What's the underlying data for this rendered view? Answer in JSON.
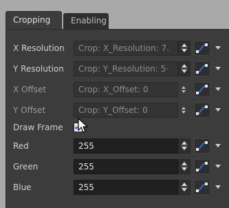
{
  "tabs": [
    {
      "label": "Cropping",
      "active": true
    },
    {
      "label": "Enabling",
      "active": false
    }
  ],
  "rows": [
    {
      "label": "X Resolution",
      "value": "Crop: X_Resolution: 7.",
      "linked": true
    },
    {
      "label": "Y Resolution",
      "value": "Crop: Y_Resolution: 5·",
      "linked": true
    },
    {
      "label": "X Offset",
      "value": "Crop: X_Offset: 0",
      "linked": true
    },
    {
      "label": "Y Offset",
      "value": "Crop: Y_Offset: 0",
      "linked": true
    },
    {
      "label": "Draw Frame",
      "checked": true
    },
    {
      "label": "Red",
      "value": "255"
    },
    {
      "label": "Green",
      "value": "255"
    },
    {
      "label": "Blue",
      "value": "255"
    }
  ],
  "icons": {
    "spin": "spinbox-arrows-icon",
    "fcurve": "function-curve-icon",
    "menu": "dropdown-arrow-icon",
    "cursor": "mouse-pointer-icon"
  },
  "colors": {
    "panel": "#3c3c3c",
    "field_linked": "#333333",
    "field_value": "#202020",
    "curve_blue": "#2a6fd6",
    "checkmark": "#1a4fbf"
  }
}
